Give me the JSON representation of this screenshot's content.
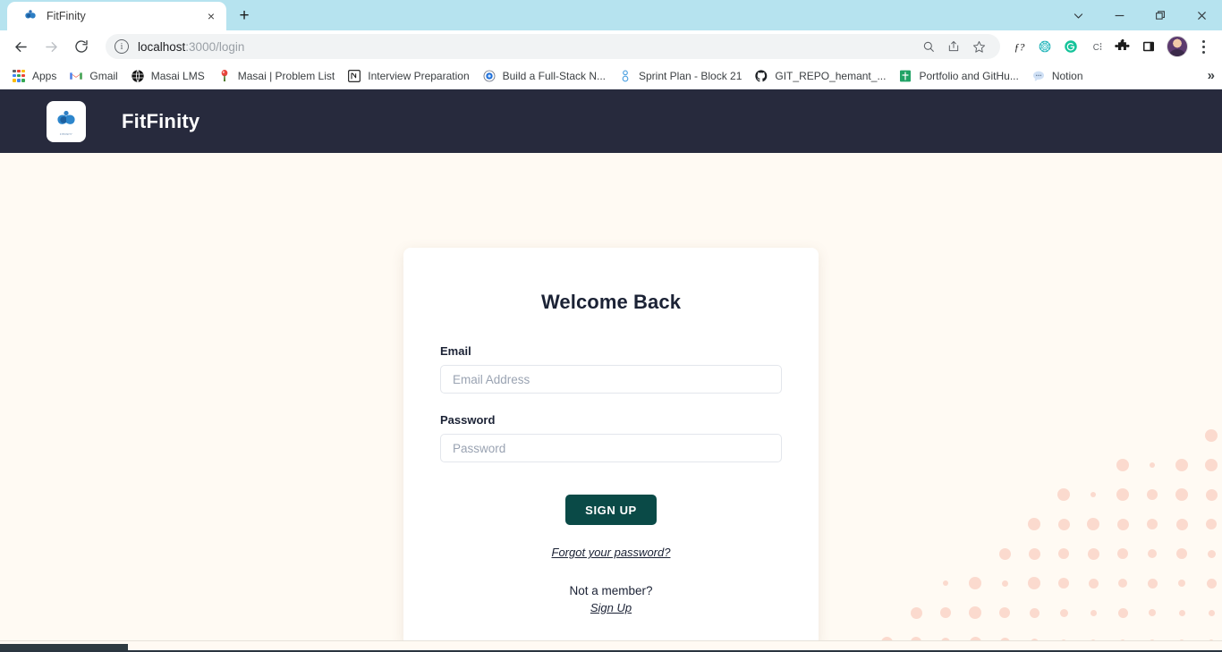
{
  "browser": {
    "tab": {
      "title": "FitFinity",
      "favicon": "fitfinity-butterfly-icon",
      "close": "×"
    },
    "new_tab_label": "+",
    "window_controls": [
      {
        "name": "tab-search",
        "glyph": "⌄"
      },
      {
        "name": "minimize",
        "glyph": "—"
      },
      {
        "name": "maximize",
        "glyph": "❐"
      },
      {
        "name": "close",
        "glyph": "✕"
      }
    ],
    "nav": {
      "back": "←",
      "forward": "→",
      "reload": "↻"
    },
    "omnibox": {
      "info_icon": "i",
      "url_host": "localhost",
      "url_path": ":3000/login",
      "actions": [
        {
          "name": "zoom-icon",
          "glyph": "⌕"
        },
        {
          "name": "share-icon",
          "glyph": "↗"
        },
        {
          "name": "bookmark-star-icon",
          "glyph": "☆"
        }
      ]
    },
    "extensions": [
      {
        "name": "fonts-ninja-icon",
        "glyph": "ƒ?"
      },
      {
        "name": "teal-web-icon",
        "glyph": "◉"
      },
      {
        "name": "grammarly-icon",
        "glyph": "G"
      },
      {
        "name": "colorzilla-icon",
        "glyph": "C⋮"
      },
      {
        "name": "extensions-puzzle-icon",
        "glyph": "❖"
      },
      {
        "name": "side-panel-icon",
        "glyph": "▣"
      }
    ],
    "profile": "user-avatar",
    "menu": "chrome-menu-icon",
    "bookmarks": [
      {
        "label": "Apps",
        "icon": "apps-grid-icon"
      },
      {
        "label": "Gmail",
        "icon": "gmail-icon"
      },
      {
        "label": "Masai LMS",
        "icon": "globe-dark-icon"
      },
      {
        "label": "Masai | Problem List",
        "icon": "pin-icon"
      },
      {
        "label": "Interview Preparation",
        "icon": "notion-icon"
      },
      {
        "label": "Build a Full-Stack N...",
        "icon": "blue-circle-icon"
      },
      {
        "label": "Sprint Plan - Block 21",
        "icon": "blue-key-icon"
      },
      {
        "label": "GIT_REPO_hemant_...",
        "icon": "github-icon"
      },
      {
        "label": "Portfolio and GitHu...",
        "icon": "green-sheets-icon"
      },
      {
        "label": "Notion",
        "icon": "chat-bubble-icon"
      }
    ],
    "bookmarks_overflow": "»"
  },
  "app": {
    "brand": "FitFinity",
    "logo": "fitfinity-butterfly-logo",
    "logo_sub": "FITFINITY"
  },
  "login": {
    "title": "Welcome Back",
    "email": {
      "label": "Email",
      "placeholder": "Email Address",
      "value": ""
    },
    "password": {
      "label": "Password",
      "placeholder": "Password",
      "value": ""
    },
    "submit_label": "SIGN UP",
    "forgot_label": "Forgot your password?",
    "member_prompt": "Not a member?",
    "signup_label": "Sign Up"
  },
  "colors": {
    "header_bg": "#272a3d",
    "page_bg": "#fffaf3",
    "card_bg": "#ffffff",
    "button_bg": "#0a4a47",
    "dot_accent": "#fbdace",
    "titlebar_bg": "#b6e3ef",
    "text_dark": "#1b2235"
  }
}
